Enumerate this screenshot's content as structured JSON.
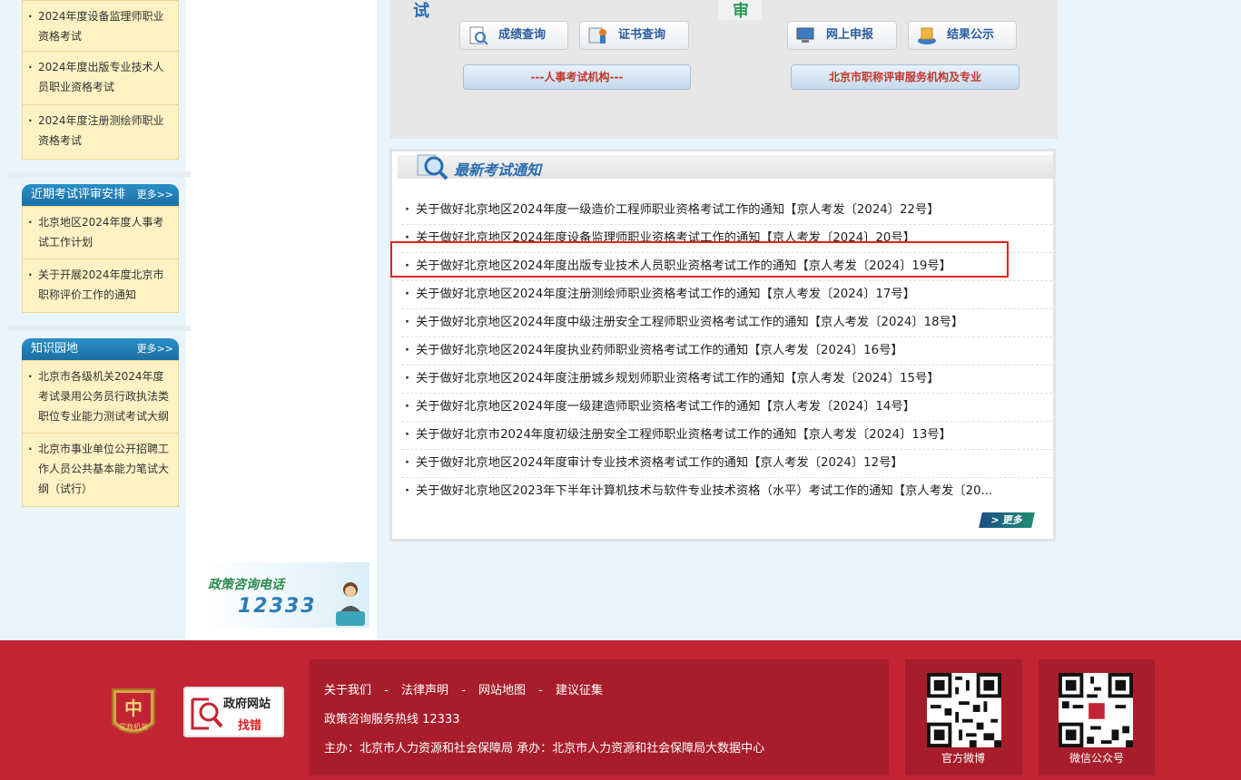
{
  "sidebar": {
    "top_items": [
      "2024年度设备监理师职业资格考试",
      "2024年度出版专业技术人员职业资格考试",
      "2024年度注册测绘师职业资格考试"
    ],
    "schedule": {
      "title": "近期考试评审安排",
      "more": "更多>>",
      "items": [
        "北京地区2024年度人事考试工作计划",
        "关于开展2024年度北京市职称评价工作的通知"
      ]
    },
    "knowledge": {
      "title": "知识园地",
      "more": "更多>>",
      "items": [
        "北京市各级机关2024年度考试录用公务员行政执法类职位专业能力测试考试大纲",
        "北京市事业单位公开招聘工作人员公共基本能力笔试大纲（试行）"
      ]
    },
    "hotline": {
      "label": "政策咨询电话",
      "number": "12333"
    }
  },
  "top_panel": {
    "left_char": "试",
    "right_char": "审",
    "buttons": {
      "score": "成绩查询",
      "cert": "证书查询",
      "online": "网上申报",
      "result": "结果公示"
    },
    "exam_org": "---人事考试机构---",
    "eval_org": "北京市职称评审服务机构及专业"
  },
  "notices": {
    "title": "最新考试通知",
    "more": "更多",
    "items": [
      "关于做好北京地区2024年度一级造价工程师职业资格考试工作的通知【京人考发〔2024〕22号】",
      "关于做好北京地区2024年度设备监理师职业资格考试工作的通知【京人考发〔2024〕20号】",
      "关于做好北京地区2024年度出版专业技术人员职业资格考试工作的通知【京人考发〔2024〕19号】",
      "关于做好北京地区2024年度注册测绘师职业资格考试工作的通知【京人考发〔2024〕17号】",
      "关于做好北京地区2024年度中级注册安全工程师职业资格考试工作的通知【京人考发〔2024〕18号】",
      "关于做好北京地区2024年度执业药师职业资格考试工作的通知【京人考发〔2024〕16号】",
      "关于做好北京地区2024年度注册城乡规划师职业资格考试工作的通知【京人考发〔2024〕15号】",
      "关于做好北京地区2024年度一级建造师职业资格考试工作的通知【京人考发〔2024〕14号】",
      "关于做好北京市2024年度初级注册安全工程师职业资格考试工作的通知【京人考发〔2024〕13号】",
      "关于做好北京地区2024年度审计专业技术资格考试工作的通知【京人考发〔2024〕12号】",
      "关于做好北京地区2023年下半年计算机技术与软件专业技术资格（水平）考试工作的通知【京人考发〔20..."
    ]
  },
  "footer": {
    "links": [
      "关于我们",
      "-",
      "法律声明",
      "-",
      "网站地图",
      "-",
      "建议征集"
    ],
    "hotline": "政策咨询服务热线 12333",
    "host": "主办：北京市人力资源和社会保障局    承办：北京市人力资源和社会保障局大数据中心",
    "party_badge": "党政机关",
    "gov_site": "政府网站",
    "gov_error": "找错",
    "weibo": "官方微博",
    "wechat": "微信公众号"
  }
}
